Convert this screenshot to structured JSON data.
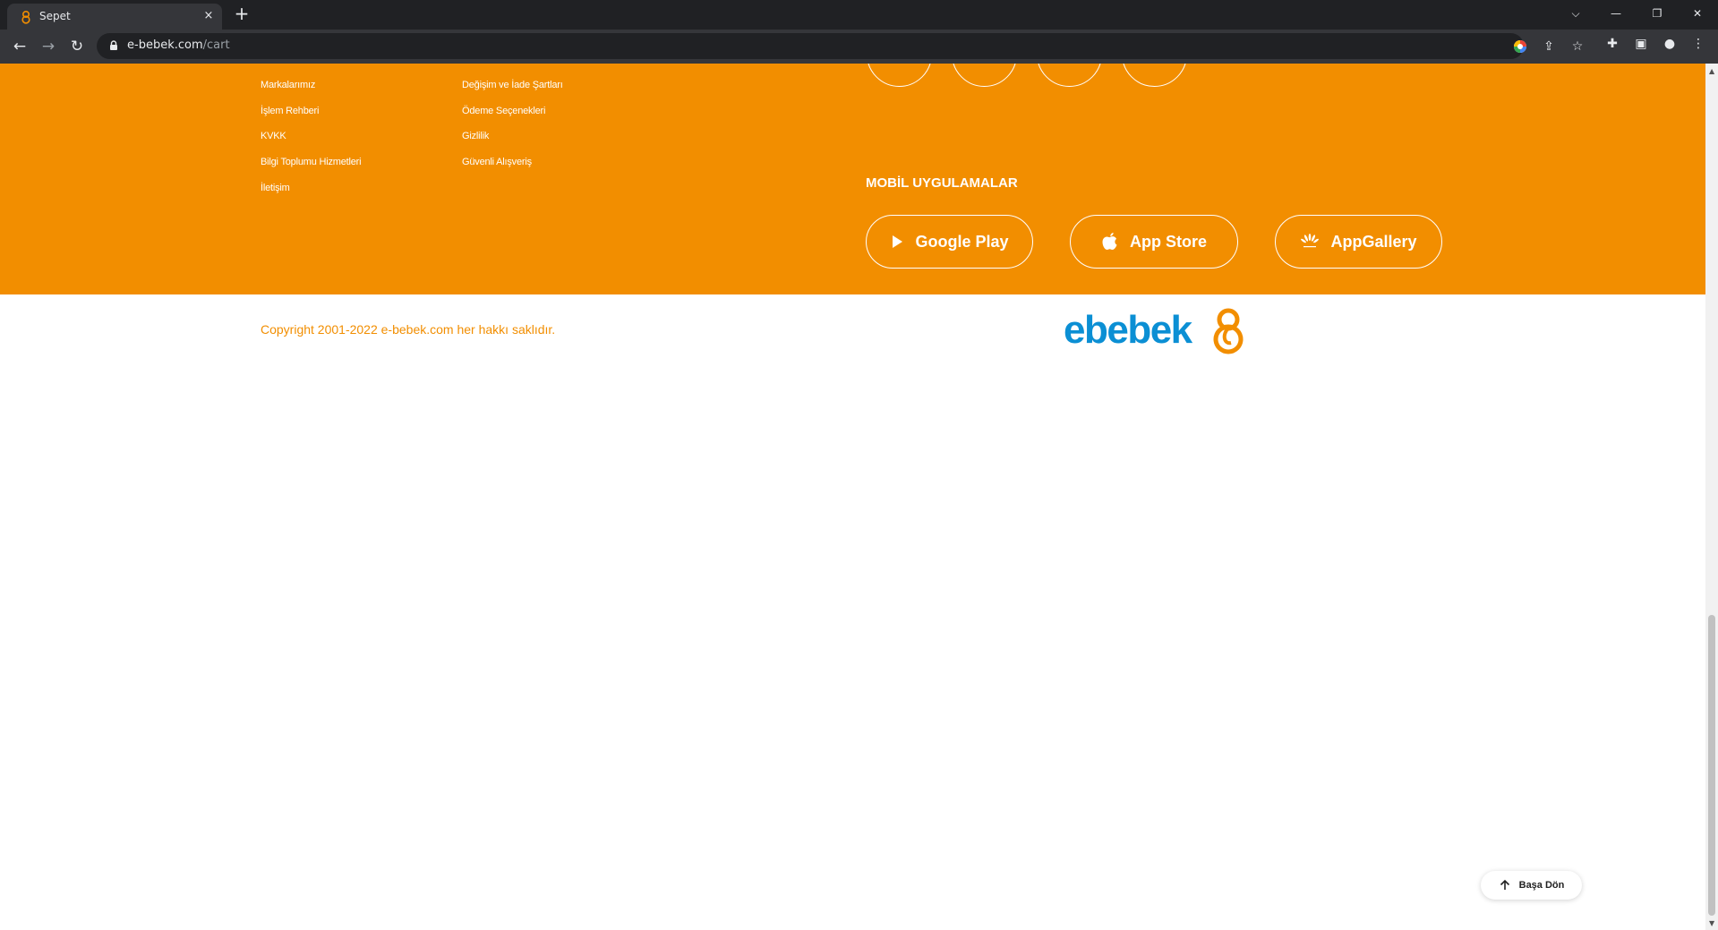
{
  "browser": {
    "tab_title": "Sepet",
    "tab_close": "×",
    "new_tab": "+",
    "url_host": "e-bebek.com",
    "url_path": "/cart",
    "win_controls": {
      "dropdown": "⌵",
      "minimize": "—",
      "restore": "❐",
      "close": "✕"
    },
    "nav": {
      "back": "←",
      "forward": "→",
      "reload": "↻"
    },
    "toolbar_icons": [
      "google-lens-icon",
      "share-icon",
      "bookmark-star-icon",
      "extensions-icon",
      "side-panel-icon",
      "profile-icon",
      "menu-icon"
    ]
  },
  "footer": {
    "col1_links": [
      "Markalarımız",
      "İşlem Rehberi",
      "KVKK",
      "Bilgi Toplumu Hizmetleri",
      "İletişim"
    ],
    "col2_links": [
      "Değişim ve İade Şartları",
      "Ödeme Seçenekleri",
      "Gizlilik",
      "Güvenli Alışveriş"
    ],
    "social_icons": [
      "instagram-icon",
      "facebook-icon",
      "twitter-icon",
      "linkedin-icon"
    ],
    "mobile_title": "MOBİL UYGULAMALAR",
    "stores": {
      "google_play": "Google Play",
      "app_store": "App Store",
      "app_gallery": "AppGallery"
    },
    "brand_color": "#f28e00"
  },
  "bottom": {
    "copyright": "Copyright 2001-2022 e-bebek.com her hakkı saklıdır.",
    "logo_text": "ebebek",
    "logo_color": "#0b8fd4"
  },
  "back_to_top": "Başa Dön"
}
